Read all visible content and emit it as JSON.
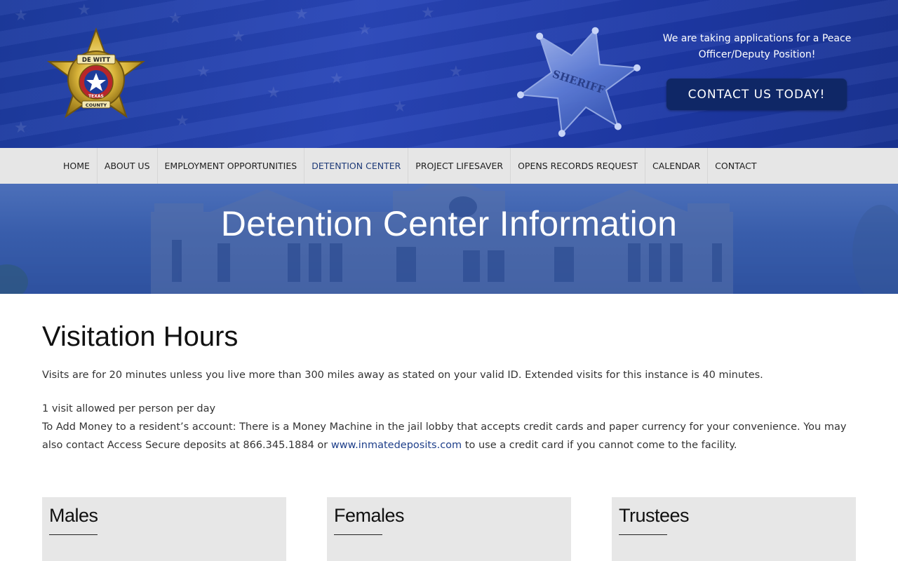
{
  "header": {
    "recruit_text": "We are taking applications for a Peace Officer/Deputy Position!",
    "cta_label": "CONTACT US TODAY!",
    "logo_text": {
      "top": "DE WITT",
      "middle": "TEXAS",
      "bottom": "COUNTY"
    },
    "badge_text": "SHERIFF",
    "colors": {
      "header_blue": "#1f3ca8",
      "cta_bg": "#0f2766",
      "badge_gold": "#d4b23a"
    }
  },
  "nav": {
    "items": [
      {
        "label": "HOME"
      },
      {
        "label": "ABOUT US"
      },
      {
        "label": "EMPLOYMENT OPPORTUNITIES"
      },
      {
        "label": "DETENTION CENTER",
        "active": true
      },
      {
        "label": "PROJECT LIFESAVER"
      },
      {
        "label": "OPENS RECORDS REQUEST"
      },
      {
        "label": "CALENDAR"
      },
      {
        "label": "CONTACT"
      }
    ],
    "active_color": "#1e3a78"
  },
  "hero": {
    "title": "Detention Center Information"
  },
  "main": {
    "section_title": "Visitation Hours",
    "para1": "Visits are for 20 minutes unless you live more than 300 miles away as stated on your valid ID. Extended visits for this instance is 40 minutes.",
    "para2": "1 visit allowed per person per day",
    "para3_before": "To Add Money to a resident’s account: There is a Money Machine in the jail lobby that accepts credit cards and paper currency for your convenience. You may also contact Access Secure deposits at 866.345.1884 or ",
    "para3_link": "www.inmatedeposits.com",
    "para3_after": " to use a credit card if you cannot come to the facility."
  },
  "cards": [
    {
      "title": "Males"
    },
    {
      "title": "Females"
    },
    {
      "title": "Trustees"
    }
  ]
}
